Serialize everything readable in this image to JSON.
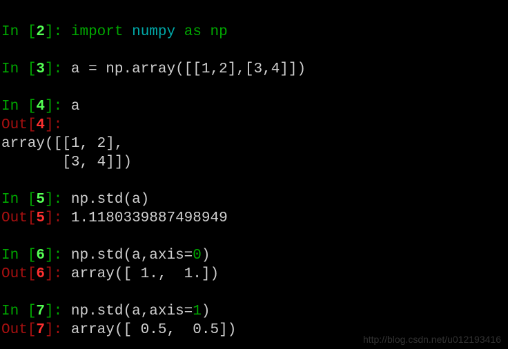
{
  "cells": {
    "c2": {
      "in_num": "2",
      "code_import": "import",
      "code_mod": "numpy",
      "code_as": "as",
      "code_alias": "np"
    },
    "c3": {
      "in_num": "3",
      "code": "a = np.array([[1,2],[3,4]])"
    },
    "c4": {
      "in_num": "4",
      "code": "a",
      "out_num": "4",
      "out_line1": "array([[1, 2],",
      "out_line2": "       [3, 4]])"
    },
    "c5": {
      "in_num": "5",
      "code": "np.std(a)",
      "out_num": "5",
      "out": "1.1180339887498949"
    },
    "c6": {
      "in_num": "6",
      "code_pre": "np.std(a,axis=",
      "axis_val": "0",
      "code_post": ")",
      "out_num": "6",
      "out": "array([ 1.,  1.])"
    },
    "c7": {
      "in_num": "7",
      "code_pre": "np.std(a,axis=",
      "axis_val": "1",
      "code_post": ")",
      "out_num": "7",
      "out": "array([ 0.5,  0.5])"
    }
  },
  "watermark": "http://blog.csdn.net/u012193416"
}
